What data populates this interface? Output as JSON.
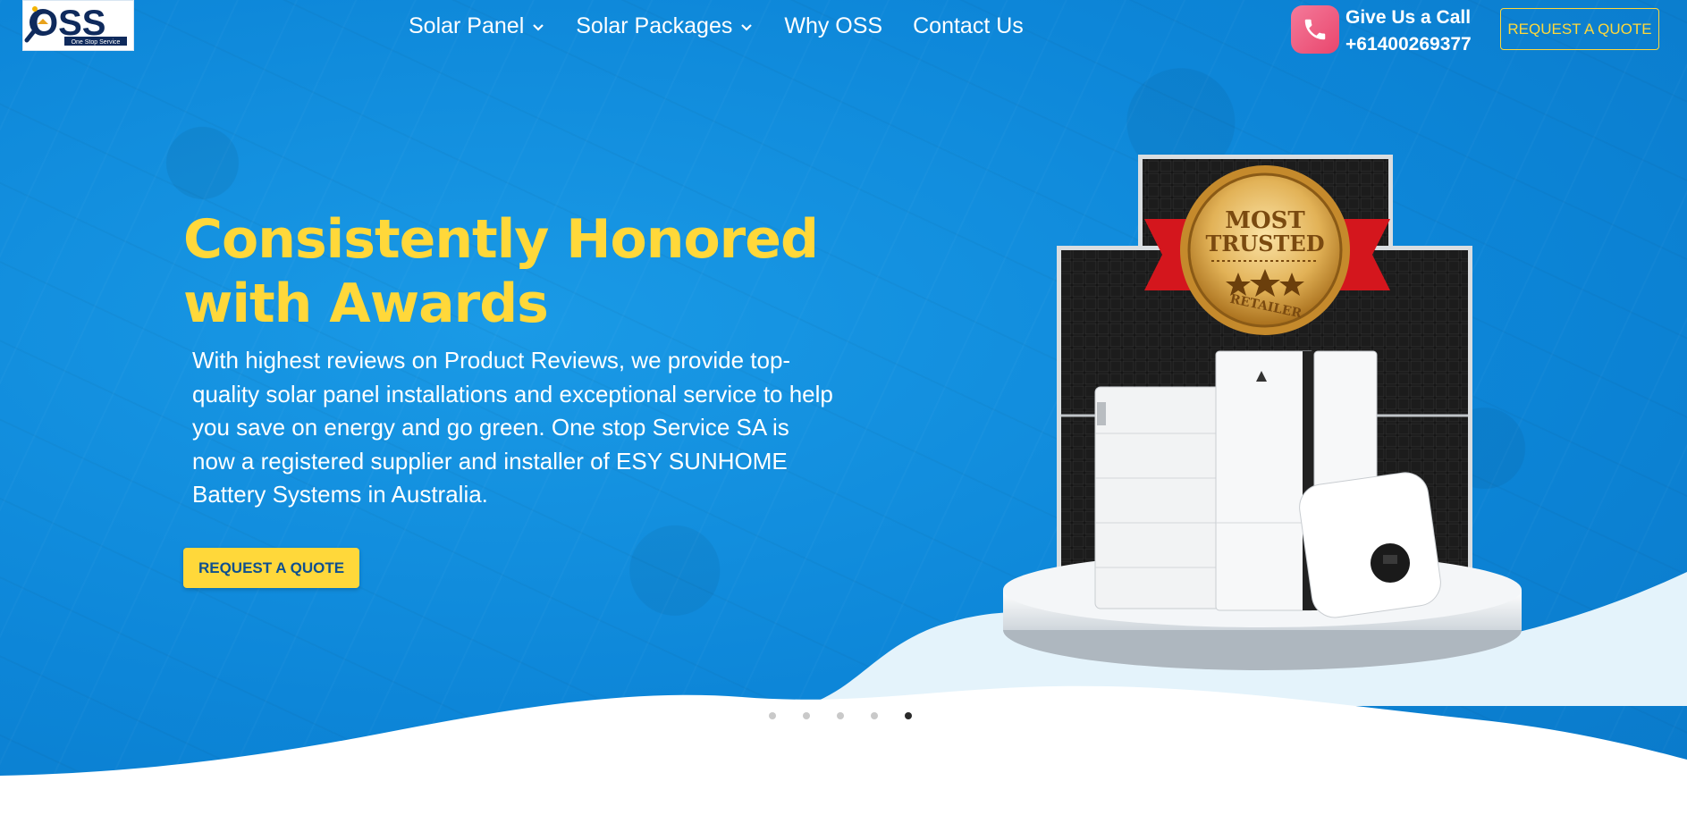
{
  "brand": {
    "logo_text": "OSS",
    "logo_tagline": "One Stop Service"
  },
  "nav": {
    "items": [
      {
        "label": "Solar Panel",
        "has_dropdown": true
      },
      {
        "label": "Solar Packages",
        "has_dropdown": true
      },
      {
        "label": "Why OSS",
        "has_dropdown": false
      },
      {
        "label": "Contact Us",
        "has_dropdown": false
      }
    ]
  },
  "contact": {
    "call_label": "Give Us a Call",
    "phone": "+61400269377",
    "icon": "phone-icon"
  },
  "header": {
    "quote_button": "REQUEST A QUOTE"
  },
  "hero": {
    "headline_line1": "Consistently Honored",
    "headline_line2": "with Awards",
    "description": "With highest reviews on Product Reviews, we provide top-quality solar panel installations and exceptional service to help you save on energy and go green. One stop Service SA is now a registered supplier and installer of ESY SUNHOME Battery Systems in Australia.",
    "quote_button": "REQUEST A QUOTE"
  },
  "badge": {
    "line1": "MOST",
    "line2": "TRUSTED",
    "line3": "RETAILER"
  },
  "carousel": {
    "slide_count": 5,
    "active_index": 4
  },
  "colors": {
    "hero_blue": "#0d86d8",
    "accent_yellow": "#ffd83a",
    "button_text": "#0e4f8f",
    "phone_pink": "#e9466d"
  }
}
